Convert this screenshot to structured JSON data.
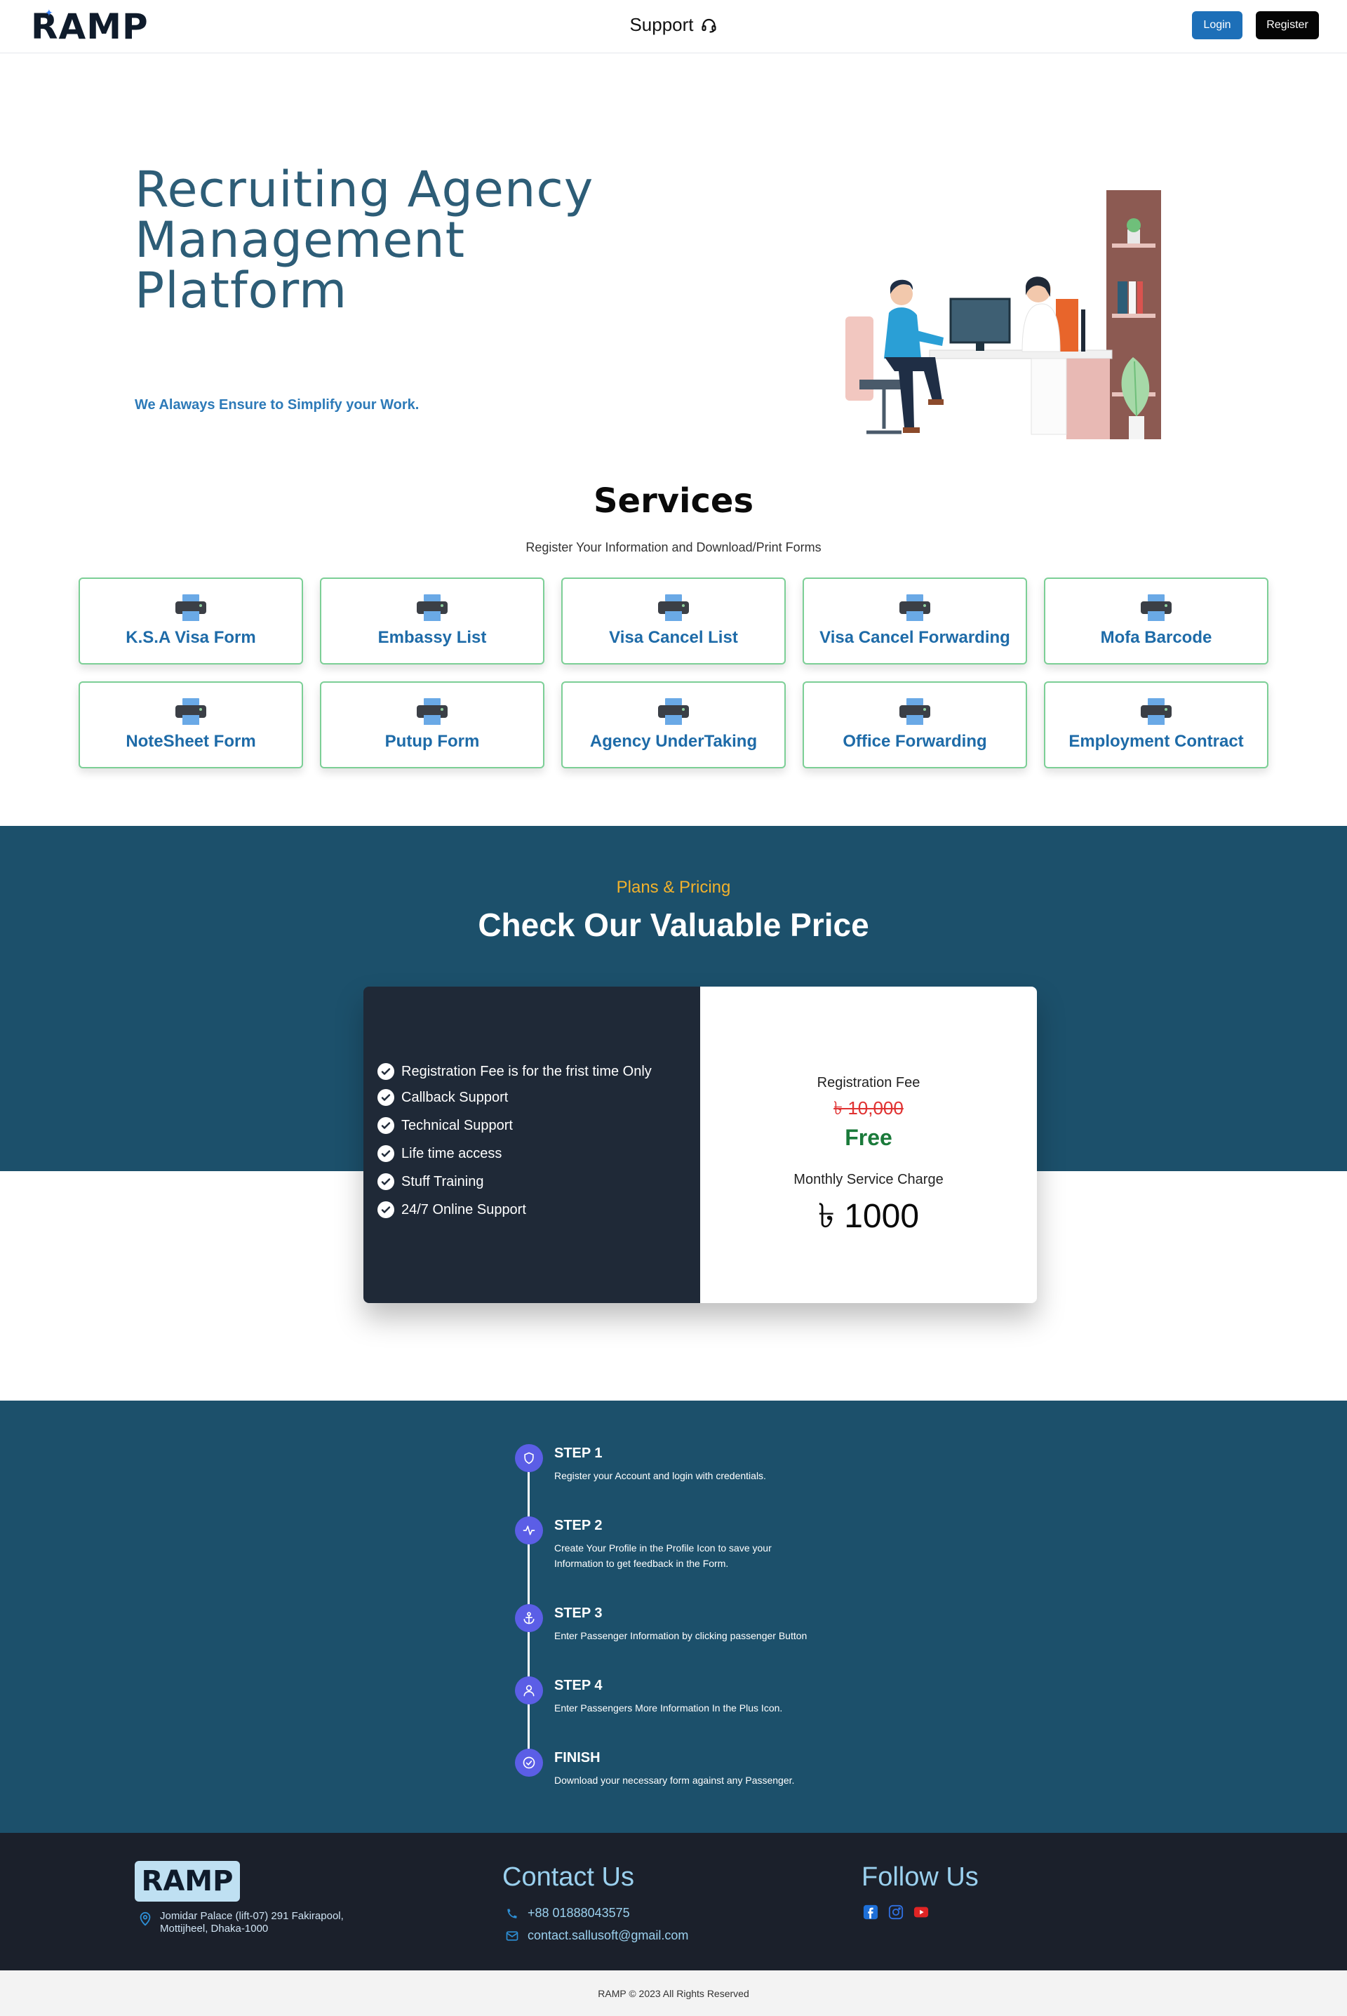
{
  "header": {
    "logo_text": "RAMP",
    "support_label": "Support",
    "login_label": "Login",
    "register_label": "Register"
  },
  "hero": {
    "title_line1": "Recruiting Agency",
    "title_line2": "Management",
    "title_line3": "Platform",
    "subtitle": "We Alaways Ensure to Simplify your Work."
  },
  "services": {
    "title": "Services",
    "subtitle": "Register Your Information and Download/Print Forms",
    "items": [
      {
        "label": "K.S.A Visa Form"
      },
      {
        "label": "Embassy List"
      },
      {
        "label": "Visa Cancel List"
      },
      {
        "label": "Visa Cancel Forwarding"
      },
      {
        "label": "Mofa Barcode"
      },
      {
        "label": "NoteSheet Form"
      },
      {
        "label": "Putup Form"
      },
      {
        "label": "Agency UnderTaking"
      },
      {
        "label": "Office Forwarding"
      },
      {
        "label": "Employment Contract"
      }
    ]
  },
  "pricing": {
    "eyebrow": "Plans & Pricing",
    "title": "Check Our Valuable Price",
    "features": [
      "Registration Fee is for the frist time Only",
      "Callback Support",
      "Technical Support",
      "Life time access",
      "Stuff Training",
      "24/7 Online Support"
    ],
    "registration_label": "Registration Fee",
    "registration_old": "৳ 10,000",
    "registration_new": "Free",
    "monthly_label": "Monthly Service Charge",
    "monthly_value": "৳ 1000"
  },
  "steps": [
    {
      "title": "STEP 1",
      "text": "Register your Account and login with credentials.",
      "icon": "shield-icon"
    },
    {
      "title": "STEP 2",
      "text": "Create Your Profile in the Profile Icon to save your Information to get feedback in the Form.",
      "icon": "activity-icon"
    },
    {
      "title": "STEP 3",
      "text": "Enter Passenger Information by clicking passenger Button",
      "icon": "anchor-icon"
    },
    {
      "title": "STEP 4",
      "text": "Enter Passengers More Information In the Plus Icon.",
      "icon": "user-icon"
    },
    {
      "title": "FINISH",
      "text": "Download your necessary form against any Passenger.",
      "icon": "check-circle-icon"
    }
  ],
  "footer": {
    "logo_text": "RAMP",
    "address_line1": "Jomidar Palace (lift-07) 291 Fakirapool,",
    "address_line2": "Mottijheel, Dhaka-1000",
    "contact_title": "Contact Us",
    "phone": "+88 01888043575",
    "email": "contact.sallusoft@gmail.com",
    "follow_title": "Follow Us",
    "social_colors": {
      "facebook": "#1d6fd8",
      "instagram": "#2f6fe0",
      "youtube": "#e02424"
    },
    "copyright": "RAMP © 2023 All Rights Reserved"
  },
  "colors": {
    "brand_dark_teal": "#1c506b",
    "hero_title": "#2d5d77",
    "accent_blue": "#1e6ba8",
    "gold": "#f1b12c",
    "card_border": "#7ccf96"
  }
}
